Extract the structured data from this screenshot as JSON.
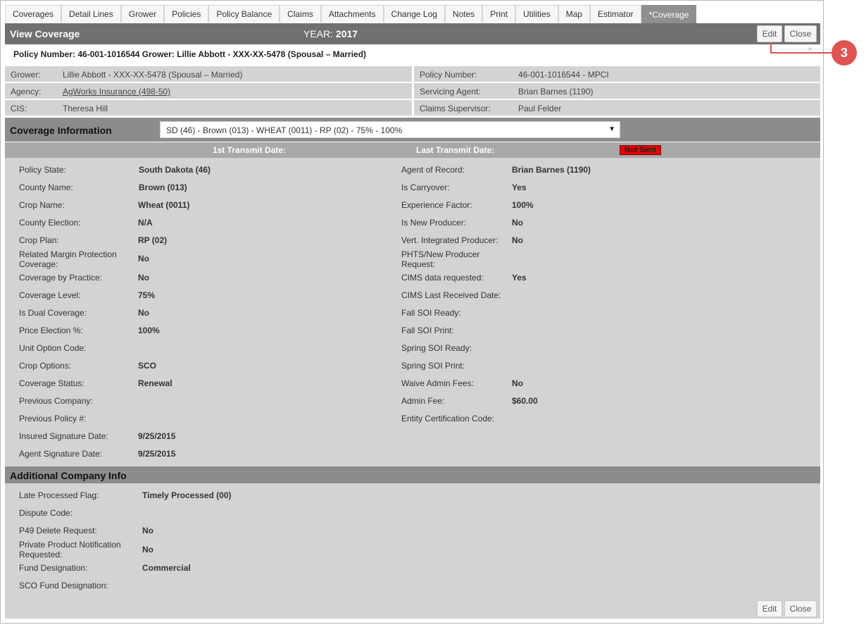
{
  "tabs": [
    "Coverages",
    "Detail Lines",
    "Grower",
    "Policies",
    "Policy Balance",
    "Claims",
    "Attachments",
    "Change Log",
    "Notes",
    "Print",
    "Utilities",
    "Map",
    "Estimator",
    "*Coverage"
  ],
  "header": {
    "title": "View Coverage",
    "year_label": "YEAR:",
    "year": "2017",
    "edit": "Edit",
    "close": "Close"
  },
  "policy_line": "Policy Number: 46-001-1016544 Grower: Lillie Abbott - XXX-XX-5478 (Spousal – Married)",
  "chevron": "^",
  "info": {
    "grower_label": "Grower:",
    "grower": "Lillie Abbott - XXX-XX-5478 (Spousal – Married)",
    "policy_number_label": "Policy Number:",
    "policy_number": "46-001-1016544 - MPCI",
    "agency_label": "Agency:",
    "agency": "AgWorks Insurance (498-50)",
    "servicing_agent_label": "Servicing Agent:",
    "servicing_agent": "Brian Barnes (1190)",
    "cis_label": "CIS:",
    "cis": "Theresa Hill",
    "claims_supervisor_label": "Claims Supervisor:",
    "claims_supervisor": "Paul Felder"
  },
  "coverage": {
    "title": "Coverage Information",
    "selected": "SD (46) - Brown (013) - WHEAT (0011) - RP (02) - 75% - 100%",
    "first_transmit_label": "1st Transmit Date:",
    "last_transmit_label": "Last Transmit Date:",
    "transmit_status": "Not Sent",
    "left": [
      {
        "label": "Policy State:",
        "value": "South Dakota (46)"
      },
      {
        "label": "County Name:",
        "value": "Brown (013)"
      },
      {
        "label": "Crop Name:",
        "value": "Wheat (0011)"
      },
      {
        "label": "County Election:",
        "value": "N/A"
      },
      {
        "label": "Crop Plan:",
        "value": "RP (02)"
      },
      {
        "label": "Related Margin Protection Coverage:",
        "value": "No"
      },
      {
        "label": "Coverage by Practice:",
        "value": "No"
      },
      {
        "label": "Coverage Level:",
        "value": "75%"
      },
      {
        "label": "Is Dual Coverage:",
        "value": "No"
      },
      {
        "label": "Price Election %:",
        "value": "100%"
      },
      {
        "label": "Unit Option Code:",
        "value": ""
      },
      {
        "label": "Crop Options:",
        "value": "SCO"
      },
      {
        "label": "Coverage Status:",
        "value": "Renewal"
      },
      {
        "label": "Previous Company:",
        "value": ""
      },
      {
        "label": "Previous Policy #:",
        "value": ""
      },
      {
        "label": "Insured Signature Date:",
        "value": "9/25/2015"
      },
      {
        "label": "Agent Signature Date:",
        "value": "9/25/2015"
      }
    ],
    "right": [
      {
        "label": "Agent of Record:",
        "value": "Brian Barnes (1190)"
      },
      {
        "label": "Is Carryover:",
        "value": "Yes"
      },
      {
        "label": "Experience Factor:",
        "value": "100%"
      },
      {
        "label": "Is New Producer:",
        "value": "No"
      },
      {
        "label": "Vert. Integrated Producer:",
        "value": "No"
      },
      {
        "label": "PHTS/New Producer Request:",
        "value": ""
      },
      {
        "label": "CIMS data requested:",
        "value": "Yes"
      },
      {
        "label": "CIMS Last Received Date:",
        "value": ""
      },
      {
        "label": "Fall SOI Ready:",
        "value": ""
      },
      {
        "label": "Fall SOI Print:",
        "value": ""
      },
      {
        "label": "Spring SOI Ready:",
        "value": ""
      },
      {
        "label": "Spring SOI Print:",
        "value": ""
      },
      {
        "label": "Waive Admin Fees:",
        "value": "No"
      },
      {
        "label": "Admin Fee:",
        "value": "$60.00"
      },
      {
        "label": "Entity Certification Code:",
        "value": ""
      }
    ]
  },
  "additional": {
    "title": "Additional Company Info",
    "fields": [
      {
        "label": "Late Processed Flag:",
        "value": "Timely Processed (00)"
      },
      {
        "label": "Dispute Code:",
        "value": ""
      },
      {
        "label": "P49 Delete Request:",
        "value": "No"
      },
      {
        "label": "Private Product Notification Requested:",
        "value": "No"
      },
      {
        "label": "Fund Designation:",
        "value": "Commercial"
      },
      {
        "label": "SCO Fund Designation:",
        "value": ""
      }
    ]
  },
  "footer": {
    "edit": "Edit",
    "close": "Close"
  },
  "callout": {
    "number": "3",
    "color": "#e05353"
  }
}
